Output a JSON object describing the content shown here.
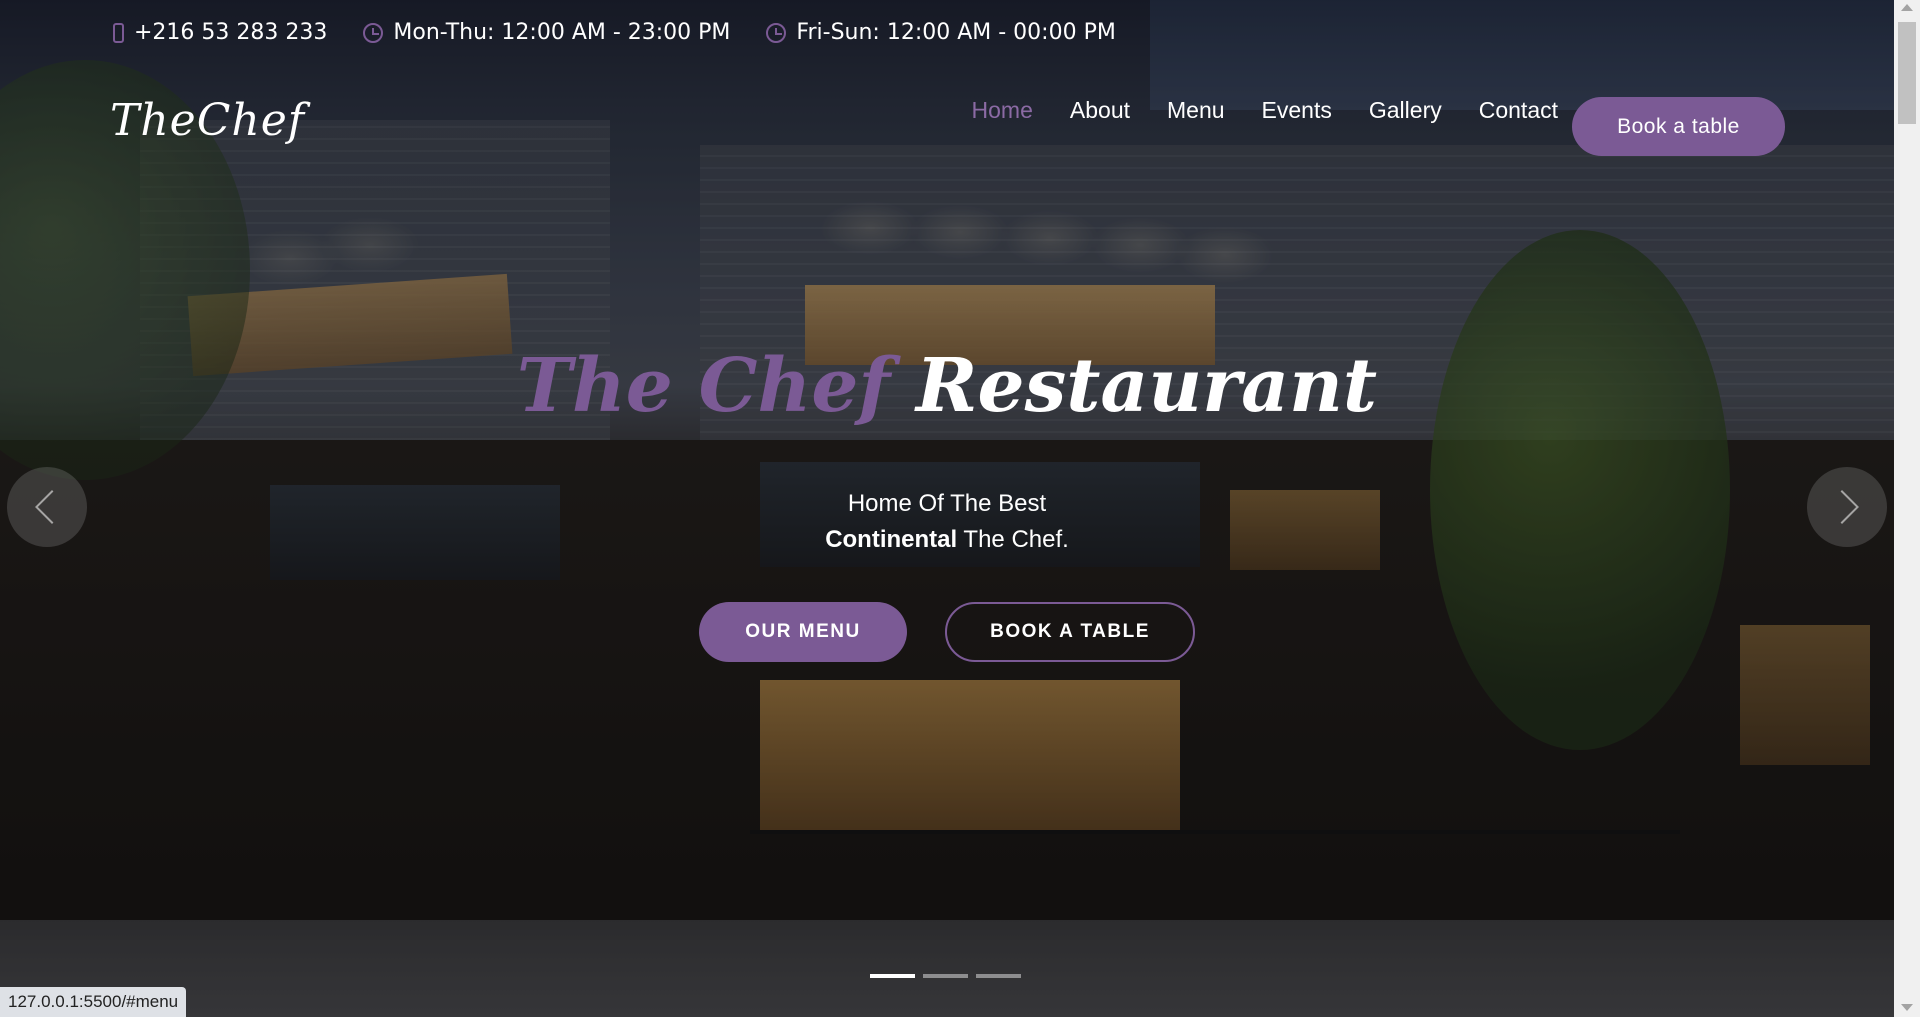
{
  "topbar": {
    "phone": "+216 53 283 233",
    "hours_weekday": "Mon-Thu: 12:00 AM - 23:00 PM",
    "hours_weekend": "Fri-Sun: 12:00 AM - 00:00 PM"
  },
  "brand": {
    "logo": "TheChef"
  },
  "nav": {
    "items": [
      {
        "label": "Home",
        "active": true
      },
      {
        "label": "About"
      },
      {
        "label": "Menu"
      },
      {
        "label": "Events"
      },
      {
        "label": "Gallery"
      },
      {
        "label": "Contact"
      }
    ],
    "cta_label": "Book a table"
  },
  "hero": {
    "title_part1": "The Chef",
    "title_part2": "Restaurant",
    "subtitle_line1": "Home Of The Best",
    "subtitle_bold": "Continental",
    "subtitle_rest": " The Chef.",
    "btn_menu": "OUR MENU",
    "btn_book": "BOOK A TABLE",
    "slide_count": 3,
    "active_slide": 1
  },
  "status_bar": {
    "url": "127.0.0.1:5500/#menu"
  },
  "colors": {
    "accent": "#7b5a95",
    "active_nav": "#8b6aa4"
  }
}
